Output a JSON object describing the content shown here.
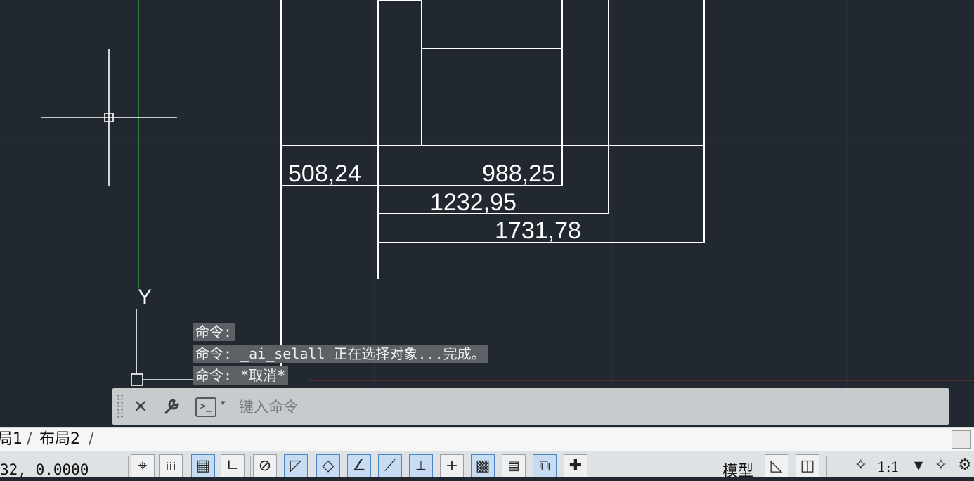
{
  "drawing": {
    "dimensions": [
      "508,24",
      "988,25",
      "1232,95",
      "1731,78"
    ],
    "ucs_y_label": "Y"
  },
  "command_history": [
    "命令:",
    "命令: _ai_selall 正在选择对象...完成。",
    "命令: *取消*"
  ],
  "command_bar": {
    "close_icon": "✕",
    "wrench_icon": "🔧",
    "prompt_symbol": ">_",
    "caret": "▾",
    "placeholder": "键入命令"
  },
  "layout_tabs": [
    "局1",
    "布局2"
  ],
  "status_bar": {
    "coordinates": "32, 0.0000",
    "model_label": "模型",
    "annotation_scale": "1:1"
  },
  "colors": {
    "canvas_bg": "#212830",
    "grid": "#2d3540",
    "y_axis": "#2f9a3f",
    "x_axis": "#b0302e",
    "linework": "#ffffff",
    "status_active": "#c7dcf3"
  }
}
